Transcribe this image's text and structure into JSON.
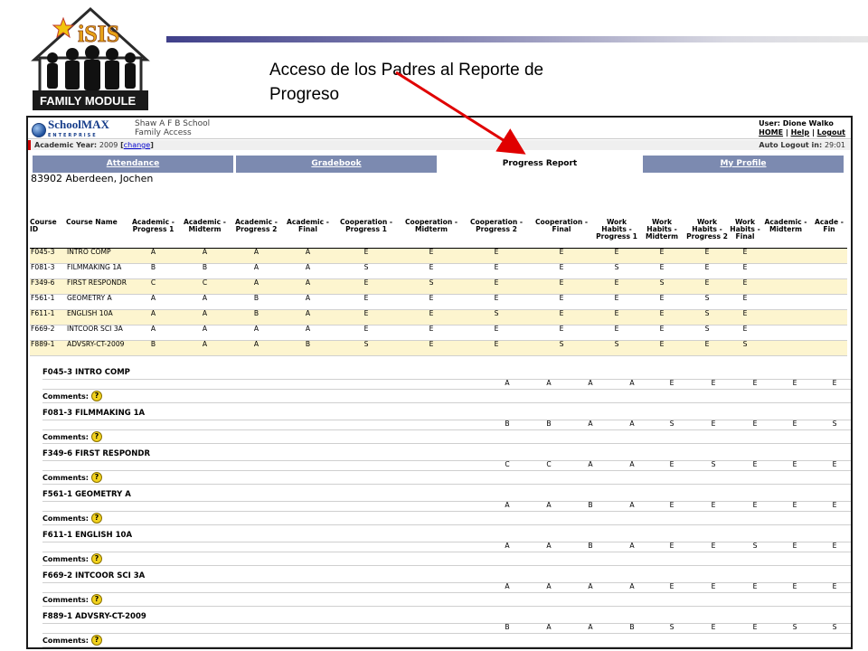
{
  "slide": {
    "logo_text": "iSIS",
    "logo_caption": "FAMILY MODULE",
    "caption": "Acceso de los Padres al Reporte de Progreso"
  },
  "app": {
    "brand": "SchoolMAX",
    "brand_sub": "ENTERPRISE",
    "school": "Shaw A F B School",
    "module": "Family Access",
    "user_label": "User:",
    "user_name": "Dione Walko",
    "links": [
      "HOME",
      "Help",
      "Logout"
    ],
    "academic_year_label": "Academic Year:",
    "academic_year": "2009",
    "change_link": "change",
    "auto_logout_label": "Auto Logout in:",
    "auto_logout": "29:01"
  },
  "tabs": [
    {
      "label": "Attendance",
      "active": false
    },
    {
      "label": "Gradebook",
      "active": false
    },
    {
      "label": "Progress Report",
      "active": true
    },
    {
      "label": "My Profile",
      "active": false
    }
  ],
  "student": "83902 Aberdeen, Jochen",
  "table": {
    "headers": [
      "Course ID",
      "Course Name",
      "Academic - Progress 1",
      "Academic - Midterm",
      "Academic - Progress 2",
      "Academic - Final",
      "Cooperation - Progress 1",
      "Cooperation - Midterm",
      "Cooperation - Progress 2",
      "Cooperation - Final",
      "Work Habits - Progress 1",
      "Work Habits - Midterm",
      "Work Habits - Progress 2",
      "Work Habits - Final",
      "Academic - Midterm",
      "Acade - Fin"
    ],
    "rows": [
      {
        "id": "F045-3",
        "name": "INTRO COMP",
        "grades": [
          "A",
          "A",
          "A",
          "A",
          "E",
          "E",
          "E",
          "E",
          "E",
          "E",
          "E",
          "E",
          "",
          ""
        ]
      },
      {
        "id": "F081-3",
        "name": "FILMMAKING 1A",
        "grades": [
          "B",
          "B",
          "A",
          "A",
          "S",
          "E",
          "E",
          "E",
          "S",
          "E",
          "E",
          "E",
          "",
          ""
        ]
      },
      {
        "id": "F349-6",
        "name": "FIRST RESPONDR",
        "grades": [
          "C",
          "C",
          "A",
          "A",
          "E",
          "S",
          "E",
          "E",
          "E",
          "S",
          "E",
          "E",
          "",
          ""
        ]
      },
      {
        "id": "F561-1",
        "name": "GEOMETRY A",
        "grades": [
          "A",
          "A",
          "B",
          "A",
          "E",
          "E",
          "E",
          "E",
          "E",
          "E",
          "S",
          "E",
          "",
          ""
        ]
      },
      {
        "id": "F611-1",
        "name": "ENGLISH 10A",
        "grades": [
          "A",
          "A",
          "B",
          "A",
          "E",
          "E",
          "S",
          "E",
          "E",
          "E",
          "S",
          "E",
          "",
          ""
        ]
      },
      {
        "id": "F669-2",
        "name": "INTCOOR SCI 3A",
        "grades": [
          "A",
          "A",
          "A",
          "A",
          "E",
          "E",
          "E",
          "E",
          "E",
          "E",
          "S",
          "E",
          "",
          ""
        ]
      },
      {
        "id": "F889-1",
        "name": "ADVSRY-CT-2009",
        "grades": [
          "B",
          "A",
          "A",
          "B",
          "S",
          "E",
          "E",
          "S",
          "S",
          "E",
          "E",
          "S",
          "",
          ""
        ]
      }
    ]
  },
  "details": [
    {
      "title": "F045-3 INTRO COMP",
      "grades": [
        "A",
        "A",
        "A",
        "A",
        "E",
        "E",
        "E",
        "E",
        "E"
      ],
      "comments_label": "Comments:"
    },
    {
      "title": "F081-3 FILMMAKING 1A",
      "grades": [
        "B",
        "B",
        "A",
        "A",
        "S",
        "E",
        "E",
        "E",
        "S"
      ],
      "comments_label": "Comments:"
    },
    {
      "title": "F349-6 FIRST RESPONDR",
      "grades": [
        "C",
        "C",
        "A",
        "A",
        "E",
        "S",
        "E",
        "E",
        "E"
      ],
      "comments_label": "Comments:"
    },
    {
      "title": "F561-1 GEOMETRY A",
      "grades": [
        "A",
        "A",
        "B",
        "A",
        "E",
        "E",
        "E",
        "E",
        "E"
      ],
      "comments_label": "Comments:"
    },
    {
      "title": "F611-1 ENGLISH 10A",
      "grades": [
        "A",
        "A",
        "B",
        "A",
        "E",
        "E",
        "S",
        "E",
        "E"
      ],
      "comments_label": "Comments:"
    },
    {
      "title": "F669-2 INTCOOR SCI 3A",
      "grades": [
        "A",
        "A",
        "A",
        "A",
        "E",
        "E",
        "E",
        "E",
        "E"
      ],
      "comments_label": "Comments:"
    },
    {
      "title": "F889-1 ADVSRY-CT-2009",
      "grades": [
        "B",
        "A",
        "A",
        "B",
        "S",
        "E",
        "E",
        "S",
        "S"
      ],
      "comments_label": "Comments:"
    }
  ],
  "help_icon": "question-mark-icon"
}
